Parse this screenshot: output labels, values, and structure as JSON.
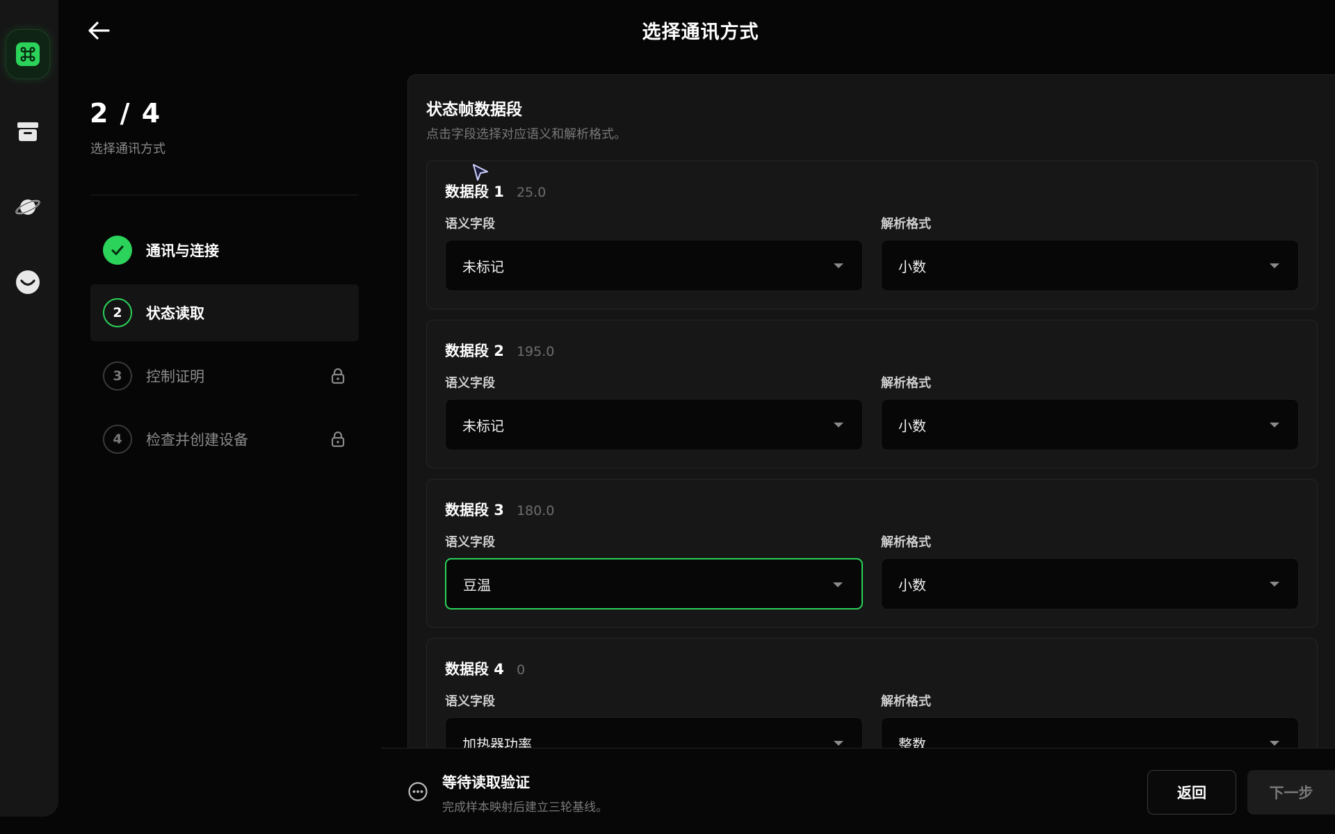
{
  "header": {
    "title": "选择通讯方式"
  },
  "stepper": {
    "counter": "2 / 4",
    "subtitle": "选择通讯方式",
    "steps": [
      {
        "number": "1",
        "label": "通讯与连接",
        "status": "done"
      },
      {
        "number": "2",
        "label": "状态读取",
        "status": "current"
      },
      {
        "number": "3",
        "label": "控制证明",
        "status": "locked"
      },
      {
        "number": "4",
        "label": "检查并创建设备",
        "status": "locked"
      }
    ]
  },
  "card": {
    "title": "状态帧数据段",
    "description": "点击字段选择对应语义和解析格式。",
    "semantic_label": "语义字段",
    "format_label": "解析格式",
    "segments": [
      {
        "name": "数据段 1",
        "value": "25.0",
        "semantic": "未标记",
        "format": "小数"
      },
      {
        "name": "数据段 2",
        "value": "195.0",
        "semantic": "未标记",
        "format": "小数"
      },
      {
        "name": "数据段 3",
        "value": "180.0",
        "semantic": "豆温",
        "format": "小数"
      },
      {
        "name": "数据段 4",
        "value": "0",
        "semantic": "加热器功率",
        "format": "整数"
      }
    ]
  },
  "footer": {
    "status_title": "等待读取验证",
    "status_desc": "完成样本映射后建立三轮基线。",
    "back_label": "返回",
    "next_label": "下一步"
  },
  "colors": {
    "accent": "#2bd35a",
    "background": "#060606",
    "card": "#151515"
  }
}
